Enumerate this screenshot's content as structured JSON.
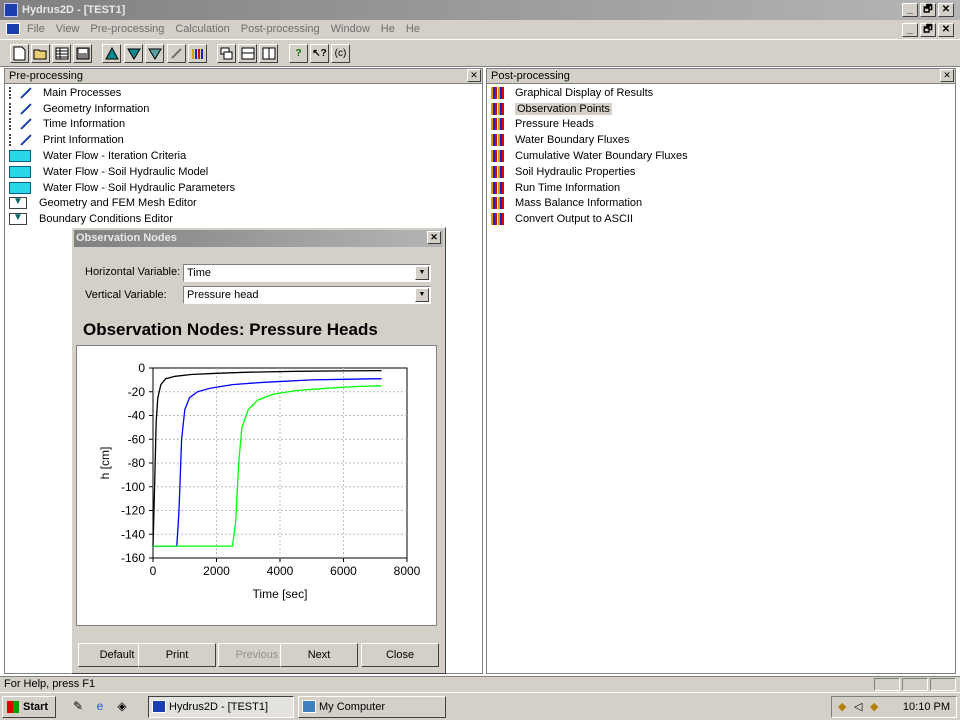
{
  "window": {
    "title": "Hydrus2D - [TEST1]",
    "controls": [
      "_",
      "🗗",
      "✕"
    ]
  },
  "menu": {
    "items": [
      "File",
      "View",
      "Pre-processing",
      "Calculation",
      "Post-processing",
      "Window",
      "He",
      "He"
    ]
  },
  "toolbar": {
    "icons": [
      "new-icon",
      "open-icon",
      "table-icon",
      "save-icon",
      "triangle-icon",
      "mesh-icon",
      "mesh2-icon",
      "pencil-icon",
      "bar-icon",
      "cascade-icon",
      "tile-h-icon",
      "tile-v-icon",
      "help-icon",
      "context-help-icon",
      "about-icon"
    ],
    "about_label": "(c)",
    "help_label": "?",
    "context_label": "?"
  },
  "pre": {
    "header": "Pre-processing",
    "items": [
      {
        "label": "Main Processes",
        "icon": "pencil"
      },
      {
        "label": "Geometry Information",
        "icon": "pencil"
      },
      {
        "label": "Time Information",
        "icon": "pencil"
      },
      {
        "label": "Print Information",
        "icon": "pencil"
      },
      {
        "label": "Water Flow - Iteration Criteria",
        "icon": "water"
      },
      {
        "label": "Water Flow - Soil Hydraulic Model",
        "icon": "water"
      },
      {
        "label": "Water Flow - Soil Hydraulic Parameters",
        "icon": "water"
      },
      {
        "label": "Geometry and FEM Mesh Editor",
        "icon": "mesh"
      },
      {
        "label": "Boundary Conditions Editor",
        "icon": "mesh"
      }
    ]
  },
  "post": {
    "header": "Post-processing",
    "selected_index": 1,
    "items": [
      "Graphical Display of Results",
      "Observation Points",
      "Pressure Heads",
      "Water Boundary Fluxes",
      "Cumulative Water Boundary Fluxes",
      "Soil Hydraulic Properties",
      "Run Time Information",
      "Mass Balance Information",
      "Convert Output to ASCII"
    ]
  },
  "dialog": {
    "title": "Observation Nodes",
    "horizontal_label": "Horizontal Variable:",
    "horizontal_value": "Time",
    "vertical_label": "Vertical Variable:",
    "vertical_value": "Pressure head",
    "chart_title": "Observation Nodes: Pressure Heads",
    "buttons": {
      "default": "Default",
      "print": "Print",
      "previous": "Previous",
      "next": "Next",
      "close": "Close"
    }
  },
  "chart_data": {
    "type": "line",
    "title": "Observation Nodes: Pressure Heads",
    "xlabel": "Time [sec]",
    "ylabel": "h [cm]",
    "xlim": [
      0,
      8000
    ],
    "ylim": [
      -160,
      0
    ],
    "xticks": [
      0,
      2000,
      4000,
      6000,
      8000
    ],
    "yticks": [
      0,
      -20,
      -40,
      -60,
      -80,
      -100,
      -120,
      -140,
      -160
    ],
    "grid": true,
    "series": [
      {
        "color": "#000000",
        "x": [
          0,
          50,
          100,
          150,
          250,
          400,
          700,
          1200,
          2000,
          3000,
          4500,
          6000,
          7200
        ],
        "y": [
          -150,
          -100,
          -45,
          -25,
          -14,
          -9,
          -7,
          -5.5,
          -4.5,
          -3.5,
          -2.8,
          -2.4,
          -2.2
        ]
      },
      {
        "color": "#0000ff",
        "x": [
          0,
          200,
          500,
          750,
          820,
          900,
          1000,
          1150,
          1400,
          1800,
          2500,
          3500,
          5000,
          6000,
          7200
        ],
        "y": [
          -150,
          -150,
          -150,
          -150,
          -120,
          -60,
          -35,
          -25,
          -20,
          -17,
          -14,
          -12,
          -10,
          -9.5,
          -9
        ]
      },
      {
        "color": "#00ff00",
        "x": [
          0,
          500,
          1500,
          2500,
          2600,
          2700,
          2800,
          3000,
          3300,
          3800,
          4500,
          5500,
          6500,
          7200
        ],
        "y": [
          -150,
          -150,
          -150,
          -150,
          -130,
          -80,
          -50,
          -35,
          -27,
          -22,
          -19,
          -17,
          -15.5,
          -15
        ]
      }
    ]
  },
  "status": {
    "text": "For Help, press F1"
  },
  "taskbar": {
    "start": "Start",
    "tasks": [
      {
        "label": "Hydrus2D - [TEST1]",
        "active": true
      },
      {
        "label": "My Computer",
        "active": false
      }
    ],
    "clock": "10:10 PM"
  }
}
